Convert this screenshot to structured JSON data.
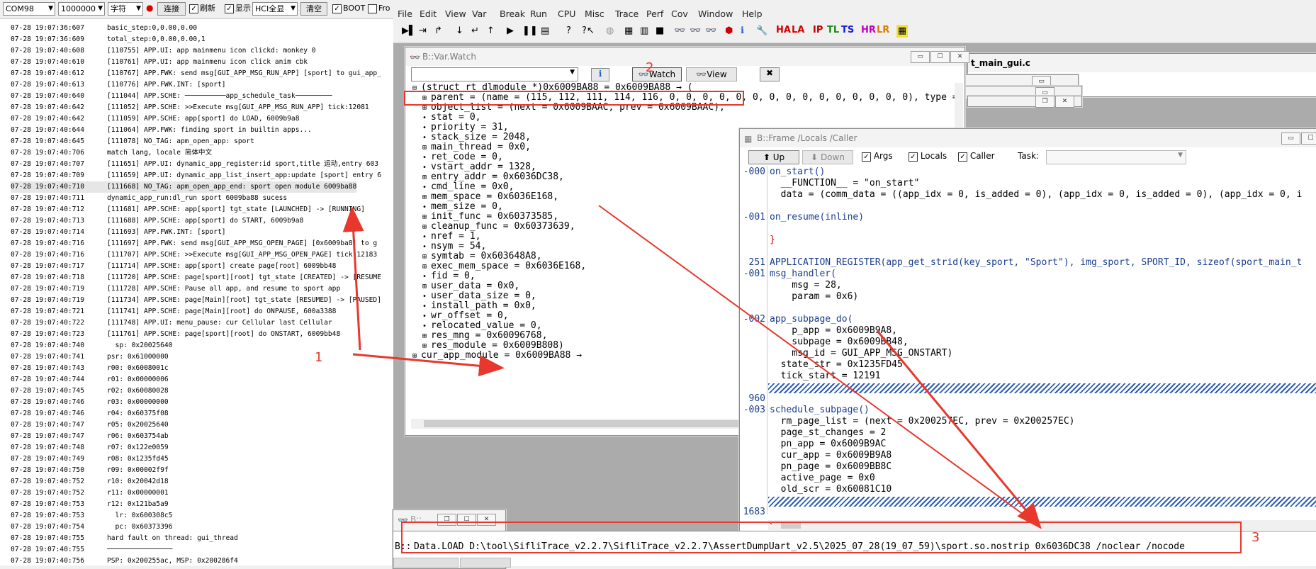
{
  "serial_toolbar": {
    "port": "COM98",
    "baud": "1000000",
    "char_mode": "字符",
    "connect": "连接",
    "refresh": "刷新",
    "display": "显示",
    "hci_mode": "HCI全显",
    "clear": "清空",
    "boot": "BOOT",
    "fro": "Fro"
  },
  "log_lines": [
    {
      "ts": "07-28 19:07:36:607",
      "msg": "basic_step:0,0.00,0.00"
    },
    {
      "ts": "07-28 19:07:36:609",
      "msg": "total_step:0,0.00,0.00,1"
    },
    {
      "ts": "07-28 19:07:40:608",
      "msg": "[110755] APP.UI: app mainmenu icon clickd: monkey 0"
    },
    {
      "ts": "07-28 19:07:40:610",
      "msg": "[110761] APP.UI: app mainmenu icon click anim cbk"
    },
    {
      "ts": "07-28 19:07:40:612",
      "msg": "[110767] APP.FWK: send msg[GUI_APP_MSG_RUN_APP] [sport] to gui_app_"
    },
    {
      "ts": "07-28 19:07:40:613",
      "msg": "[110776] APP.FWK.INT: [sport]"
    },
    {
      "ts": "07-28 19:07:40:640",
      "msg": "[111044] APP.SCHE: ──────────app_schedule_task─────────"
    },
    {
      "ts": "07-28 19:07:40:642",
      "msg": "[111052] APP.SCHE: >>Execute msg[GUI_APP_MSG_RUN_APP] tick:12081"
    },
    {
      "ts": "07-28 19:07:40:642",
      "msg": "[111059] APP.SCHE: app[sport] do LOAD, 6009b9a8"
    },
    {
      "ts": "07-28 19:07:40:644",
      "msg": "[111064] APP.FWK: finding sport in builtin apps..."
    },
    {
      "ts": "07-28 19:07:40:645",
      "msg": "[111078] NO_TAG: apm_open_app: sport"
    },
    {
      "ts": "07-28 19:07:40:706",
      "msg": "match lang, locale 简体中文"
    },
    {
      "ts": "07-28 19:07:40:707",
      "msg": "[111651] APP.UI: dynamic_app_register:id sport,title 运动,entry 603"
    },
    {
      "ts": "07-28 19:07:40:709",
      "msg": "[111659] APP.UI: dynamic_app_list_insert_app:update [sport] entry 6"
    },
    {
      "ts": "07-28 19:07:40:710",
      "msg": "[111668] NO_TAG: apm_open_app_end: sport open module 6009ba88",
      "hl": true
    },
    {
      "ts": "07-28 19:07:40:711",
      "msg": "dynamic_app_run:dl_run sport 6009ba88 sucess"
    },
    {
      "ts": "07-28 19:07:40:712",
      "msg": "[111681] APP.SCHE: app[sport] tgt_state [LAUNCHED] -> [RUNNING]"
    },
    {
      "ts": "07-28 19:07:40:713",
      "msg": "[111688] APP.SCHE: app[sport] do START, 6009b9a8"
    },
    {
      "ts": "07-28 19:07:40:714",
      "msg": "[111693] APP.FWK.INT: [sport]"
    },
    {
      "ts": "07-28 19:07:40:716",
      "msg": "[111697] APP.FWK: send msg[GUI_APP_MSG_OPEN_PAGE] [0x6009ba8] to g"
    },
    {
      "ts": "07-28 19:07:40:716",
      "msg": "[111707] APP.SCHE: >>Execute msg[GUI_APP_MSG_OPEN_PAGE] tick:12183"
    },
    {
      "ts": "07-28 19:07:40:717",
      "msg": "[111714] APP.SCHE: app[sport] create page[root] 6009bb48"
    },
    {
      "ts": "07-28 19:07:40:718",
      "msg": "[111720] APP.SCHE: page[sport][root] tgt_state [CREATED] -> [RESUME"
    },
    {
      "ts": "07-28 19:07:40:719",
      "msg": "[111728] APP.SCHE: Pause all app, and resume to sport app"
    },
    {
      "ts": "07-28 19:07:40:719",
      "msg": "[111734] APP.SCHE: page[Main][root] tgt_state [RESUMED] -> [PAUSED]"
    },
    {
      "ts": "07-28 19:07:40:721",
      "msg": "[111741] APP.SCHE: page[Main][root] do ONPAUSE, 600a3388"
    },
    {
      "ts": "07-28 19:07:40:722",
      "msg": "[111748] APP.UI: menu_pause: cur Cellular last Cellular"
    },
    {
      "ts": "07-28 19:07:40:723",
      "msg": "[111761] APP.SCHE: page[sport][root] do ONSTART, 6009bb48"
    },
    {
      "ts": "07-28 19:07:40:740",
      "msg": "  sp: 0x20025640"
    },
    {
      "ts": "07-28 19:07:40:741",
      "msg": "psr: 0x61000000"
    },
    {
      "ts": "07-28 19:07:40:743",
      "msg": "r00: 0x6008001c"
    },
    {
      "ts": "07-28 19:07:40:744",
      "msg": "r01: 0x00000006"
    },
    {
      "ts": "07-28 19:07:40:745",
      "msg": "r02: 0x60080028"
    },
    {
      "ts": "07-28 19:07:40:746",
      "msg": "r03: 0x00000000"
    },
    {
      "ts": "07-28 19:07:40:746",
      "msg": "r04: 0x60375f08"
    },
    {
      "ts": "07-28 19:07:40:747",
      "msg": "r05: 0x20025640"
    },
    {
      "ts": "07-28 19:07:40:747",
      "msg": "r06: 0x603754ab"
    },
    {
      "ts": "07-28 19:07:40:748",
      "msg": "r07: 0x122e0059"
    },
    {
      "ts": "07-28 19:07:40:749",
      "msg": "r08: 0x1235fd45"
    },
    {
      "ts": "07-28 19:07:40:750",
      "msg": "r09: 0x00002f9f"
    },
    {
      "ts": "07-28 19:07:40:752",
      "msg": "r10: 0x20042d18"
    },
    {
      "ts": "07-28 19:07:40:752",
      "msg": "r11: 0x00000001"
    },
    {
      "ts": "07-28 19:07:40:753",
      "msg": "r12: 0x121ba5a9"
    },
    {
      "ts": "07-28 19:07:40:753",
      "msg": "  lr: 0x600308c5"
    },
    {
      "ts": "07-28 19:07:40:754",
      "msg": "  pc: 0x60373396"
    },
    {
      "ts": "07-28 19:07:40:755",
      "msg": "hard fault on thread: gui_thread"
    },
    {
      "ts": "07-28 19:07:40:755",
      "msg": "────────────────"
    },
    {
      "ts": "07-28 19:07:40:756",
      "msg": "PSP: 0x200255ac, MSP: 0x200286f4"
    }
  ],
  "menu": [
    "File",
    "Edit",
    "View",
    "Var",
    "Break",
    "Run",
    "CPU",
    "Misc",
    "Trace",
    "Perf",
    "Cov",
    "Window",
    "Help"
  ],
  "toolbar_text": {
    "ha": "HA",
    "la": "LA",
    "ip": "IP",
    "tl": "TL",
    "ts": "TS",
    "hr": "HR",
    "lr": "LR"
  },
  "colors": {
    "annotation": "#e8382d",
    "hatch": "#2e5db5",
    "ha": "#d40000",
    "ip": "#c00000",
    "tl": "#1a8a1a",
    "ts": "#1a1ad8",
    "hr": "#c000c0",
    "lr": "#d87a00"
  },
  "var_watch": {
    "title": "B::Var.Watch",
    "watch_btn": "Watch",
    "view_btn": "View",
    "lines": [
      "(struct rt_dlmodule *)0x6009BA88 = 0x6009BA88 → (",
      "parent = (name = (115, 112, 111, 114, 116, 0, 0, 0, 0, 0, 0, 0, 0, 0, 0, 0, 0, 0, 0, 0), type =",
      "object_list = (next = 0x6009BAAC, prev = 0x6009BAAC),",
      "stat = 0,",
      "priority = 31,",
      "stack_size = 2048,",
      "main_thread = 0x0,",
      "ret_code = 0,",
      "vstart_addr = 1328,",
      "entry_addr = 0x6036DC38,",
      "cmd_line = 0x0,",
      "mem_space = 0x6036E168,",
      "mem_size = 0,",
      "init_func = 0x60373585,",
      "cleanup_func = 0x60373639,",
      "nref = 1,",
      "nsym = 54,",
      "symtab = 0x603648A8,",
      "exec_mem_space = 0x6036E168,",
      "fid = 0,",
      "user_data = 0x0,",
      "user_data_size = 0,",
      "install_path = 0x0,",
      "wr_offset = 0,",
      "relocated_value = 0,",
      "res_mng = 0x60096768,",
      "res_module = 0x6009B808)",
      "cur_app_module = 0x6009BA88 →"
    ]
  },
  "bg_window_title": "t_main_gui.c",
  "frame": {
    "title": "B::Frame /Locals /Caller",
    "up": "Up",
    "down": "Down",
    "args": "Args",
    "locals": "Locals",
    "caller": "Caller",
    "task_label": "Task:",
    "gutter": [
      "-000",
      "",
      "",
      "",
      "-001",
      "",
      "",
      "",
      "251",
      "-001",
      "",
      "",
      "",
      "-002",
      "",
      "",
      "",
      "",
      "",
      "",
      "960",
      "-003",
      "",
      "",
      "",
      "",
      "",
      "",
      "",
      "",
      "1683"
    ],
    "lines": [
      "on_start()",
      "  __FUNCTION__ = \"on_start\"",
      "  data = (comm_data = ((app_idx = 0, is_added = 0), (app_idx = 0, is_added = 0), (app_idx = 0, i",
      "",
      "on_resume(inline)",
      "",
      "}",
      "",
      "APPLICATION_REGISTER(app_get_strid(key_sport, \"Sport\"), img_sport, SPORT_ID, sizeof(sport_main_t",
      "msg_handler(",
      "    msg = 28,",
      "    param = 0x6)",
      "",
      "app_subpage_do(",
      "    p_app = 0x6009B9A8,",
      "    subpage = 0x6009BB48,",
      "    msg_id = GUI_APP_MSG_ONSTART)",
      "  state_str = 0x1235FD45",
      "  tick_start = 12191",
      "",
      "",
      "schedule_subpage()",
      "  rm_page_list = (next = 0x200257EC, prev = 0x200257EC)",
      "  page_st_changes = 2",
      "  pn_app = 0x6009B9AC",
      "  cur_app = 0x6009B9A8",
      "  pn_page = 0x6009BB8C",
      "  active_page = 0x0",
      "  old_scr = 0x60081C10",
      "",
      ""
    ]
  },
  "cmd": {
    "title": "B::...",
    "prompt": "B::",
    "text": "Data.LOAD D:\\tool\\SifliTrace_v2.2.7\\SifliTrace_v2.2.7\\AssertDumpUart_v2.5\\2025_07_28(19_07_59)\\sport.so.nostrip 0x6036DC38 /noclear /nocode"
  },
  "annotations": [
    "1",
    "2",
    "3"
  ]
}
